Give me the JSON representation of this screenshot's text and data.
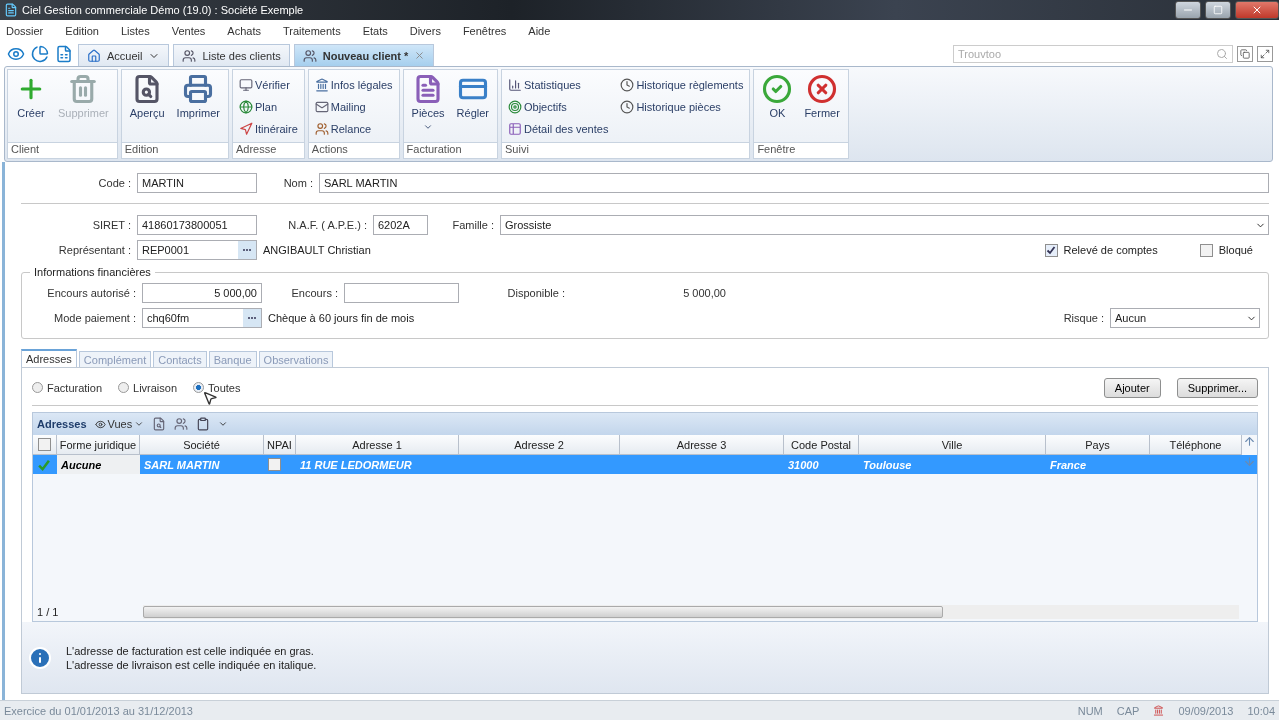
{
  "window": {
    "title": "Ciel Gestion commerciale Démo (19.0) : Société Exemple"
  },
  "menu": [
    "Dossier",
    "Edition",
    "Listes",
    "Ventes",
    "Achats",
    "Traitements",
    "Etats",
    "Divers",
    "Fenêtres",
    "Aide"
  ],
  "doc_tabs": [
    {
      "label": "Accueil",
      "selected": false,
      "kind": "home"
    },
    {
      "label": "Liste des clients",
      "selected": false,
      "kind": "page"
    },
    {
      "label": "Nouveau client *",
      "selected": true,
      "kind": "closable"
    }
  ],
  "search": {
    "placeholder": "Trouvtoo"
  },
  "ribbon": [
    {
      "label": "Client",
      "items": [
        {
          "label": "Créer",
          "kind": "large",
          "disabled": false
        },
        {
          "label": "Supprimer",
          "kind": "large",
          "disabled": true
        }
      ]
    },
    {
      "label": "Edition",
      "items": [
        {
          "label": "Aperçu",
          "kind": "large",
          "disabled": false
        },
        {
          "label": "Imprimer",
          "kind": "large",
          "disabled": false
        }
      ]
    },
    {
      "label": "Adresse",
      "items": [
        {
          "label": "Vérifier",
          "kind": "small",
          "disabled": false
        },
        {
          "label": "Plan",
          "kind": "small",
          "disabled": false
        },
        {
          "label": "Itinéraire",
          "kind": "small",
          "disabled": false
        }
      ]
    },
    {
      "label": "Actions",
      "items": [
        {
          "label": "Infos légales",
          "kind": "small",
          "disabled": false
        },
        {
          "label": "Mailing",
          "kind": "small",
          "disabled": false
        },
        {
          "label": "Relance",
          "kind": "small",
          "disabled": false
        }
      ]
    },
    {
      "label": "Facturation",
      "items": [
        {
          "label": "Pièces",
          "kind": "menu",
          "disabled": false
        },
        {
          "label": "Régler",
          "kind": "large",
          "disabled": false
        }
      ]
    },
    {
      "label": "Suivi",
      "items": [
        {
          "label": "Statistiques",
          "kind": "small",
          "disabled": false
        },
        {
          "label": "Objectifs",
          "kind": "small",
          "disabled": false
        },
        {
          "label": "Détail des ventes",
          "kind": "small",
          "disabled": false
        },
        {
          "label": "Historique règlements",
          "kind": "small",
          "disabled": false
        },
        {
          "label": "Historique pièces",
          "kind": "small",
          "disabled": false
        }
      ]
    },
    {
      "label": "Fenêtre",
      "items": [
        {
          "label": "OK",
          "kind": "large",
          "disabled": false
        },
        {
          "label": "Fermer",
          "kind": "large",
          "disabled": false
        }
      ]
    }
  ],
  "form": {
    "code": {
      "label": "Code :",
      "value": "MARTIN"
    },
    "nom": {
      "label": "Nom :",
      "value": "SARL MARTIN"
    },
    "siret": {
      "label": "SIRET :",
      "value": "41860173800051"
    },
    "naf": {
      "label": "N.A.F. ( A.P.E.) :",
      "value": "6202A"
    },
    "famille": {
      "label": "Famille :",
      "value": "Grossiste"
    },
    "representant": {
      "label": "Représentant :",
      "value": "REP0001",
      "name": "ANGIBAULT Christian"
    },
    "releve": {
      "label": "Relevé de comptes",
      "checked": true
    },
    "bloque": {
      "label": "Bloqué",
      "checked": false
    }
  },
  "finance": {
    "title": "Informations financières",
    "encours_autorise": {
      "label": "Encours autorisé :",
      "value": "5 000,00"
    },
    "encours": {
      "label": "Encours :"
    },
    "disponible": {
      "label": "Disponible :",
      "value": "5 000,00"
    },
    "mode_paiement": {
      "label": "Mode paiement :",
      "value": "chq60fm",
      "description": "Chèque à 60 jours fin de mois"
    },
    "risque": {
      "label": "Risque :",
      "value": "Aucun"
    }
  },
  "tabs": [
    {
      "label": "Adresses",
      "selected": true
    },
    {
      "label": "Complément",
      "selected": false
    },
    {
      "label": "Contacts",
      "selected": false
    },
    {
      "label": "Banque",
      "selected": false
    },
    {
      "label": "Observations",
      "selected": false
    }
  ],
  "address_filter": [
    {
      "label": "Facturation",
      "selected": false
    },
    {
      "label": "Livraison",
      "selected": false
    },
    {
      "label": "Toutes",
      "selected": true
    }
  ],
  "buttons": [
    "Ajouter",
    "Supprimer..."
  ],
  "grid": {
    "title": "Adresses",
    "views": "Vues",
    "select_all": false,
    "columns": [
      "Forme juridique",
      "Société",
      "NPAI",
      "Adresse 1",
      "Adresse 2",
      "Adresse 3",
      "Code Postal",
      "Ville",
      "Pays",
      "Téléphone"
    ],
    "rows": [
      {
        "selected": true,
        "checked": true,
        "forme_juridique": "Aucune",
        "societe": "SARL MARTIN",
        "npai": false,
        "adresse_1": "11 RUE LEDORMEUR",
        "code_postal": "31000",
        "ville": "Toulouse",
        "pays": "France"
      }
    ],
    "pager": "1 / 1"
  },
  "notes": [
    "L'adresse de facturation est celle indiquée en gras.",
    "L'adresse de livraison est celle indiquée en italique."
  ],
  "status_bar": {
    "period": "Exercice du 01/01/2013 au 31/12/2013",
    "num": "NUM",
    "cap": "CAP",
    "date": "09/09/2013",
    "time": "10:04"
  }
}
